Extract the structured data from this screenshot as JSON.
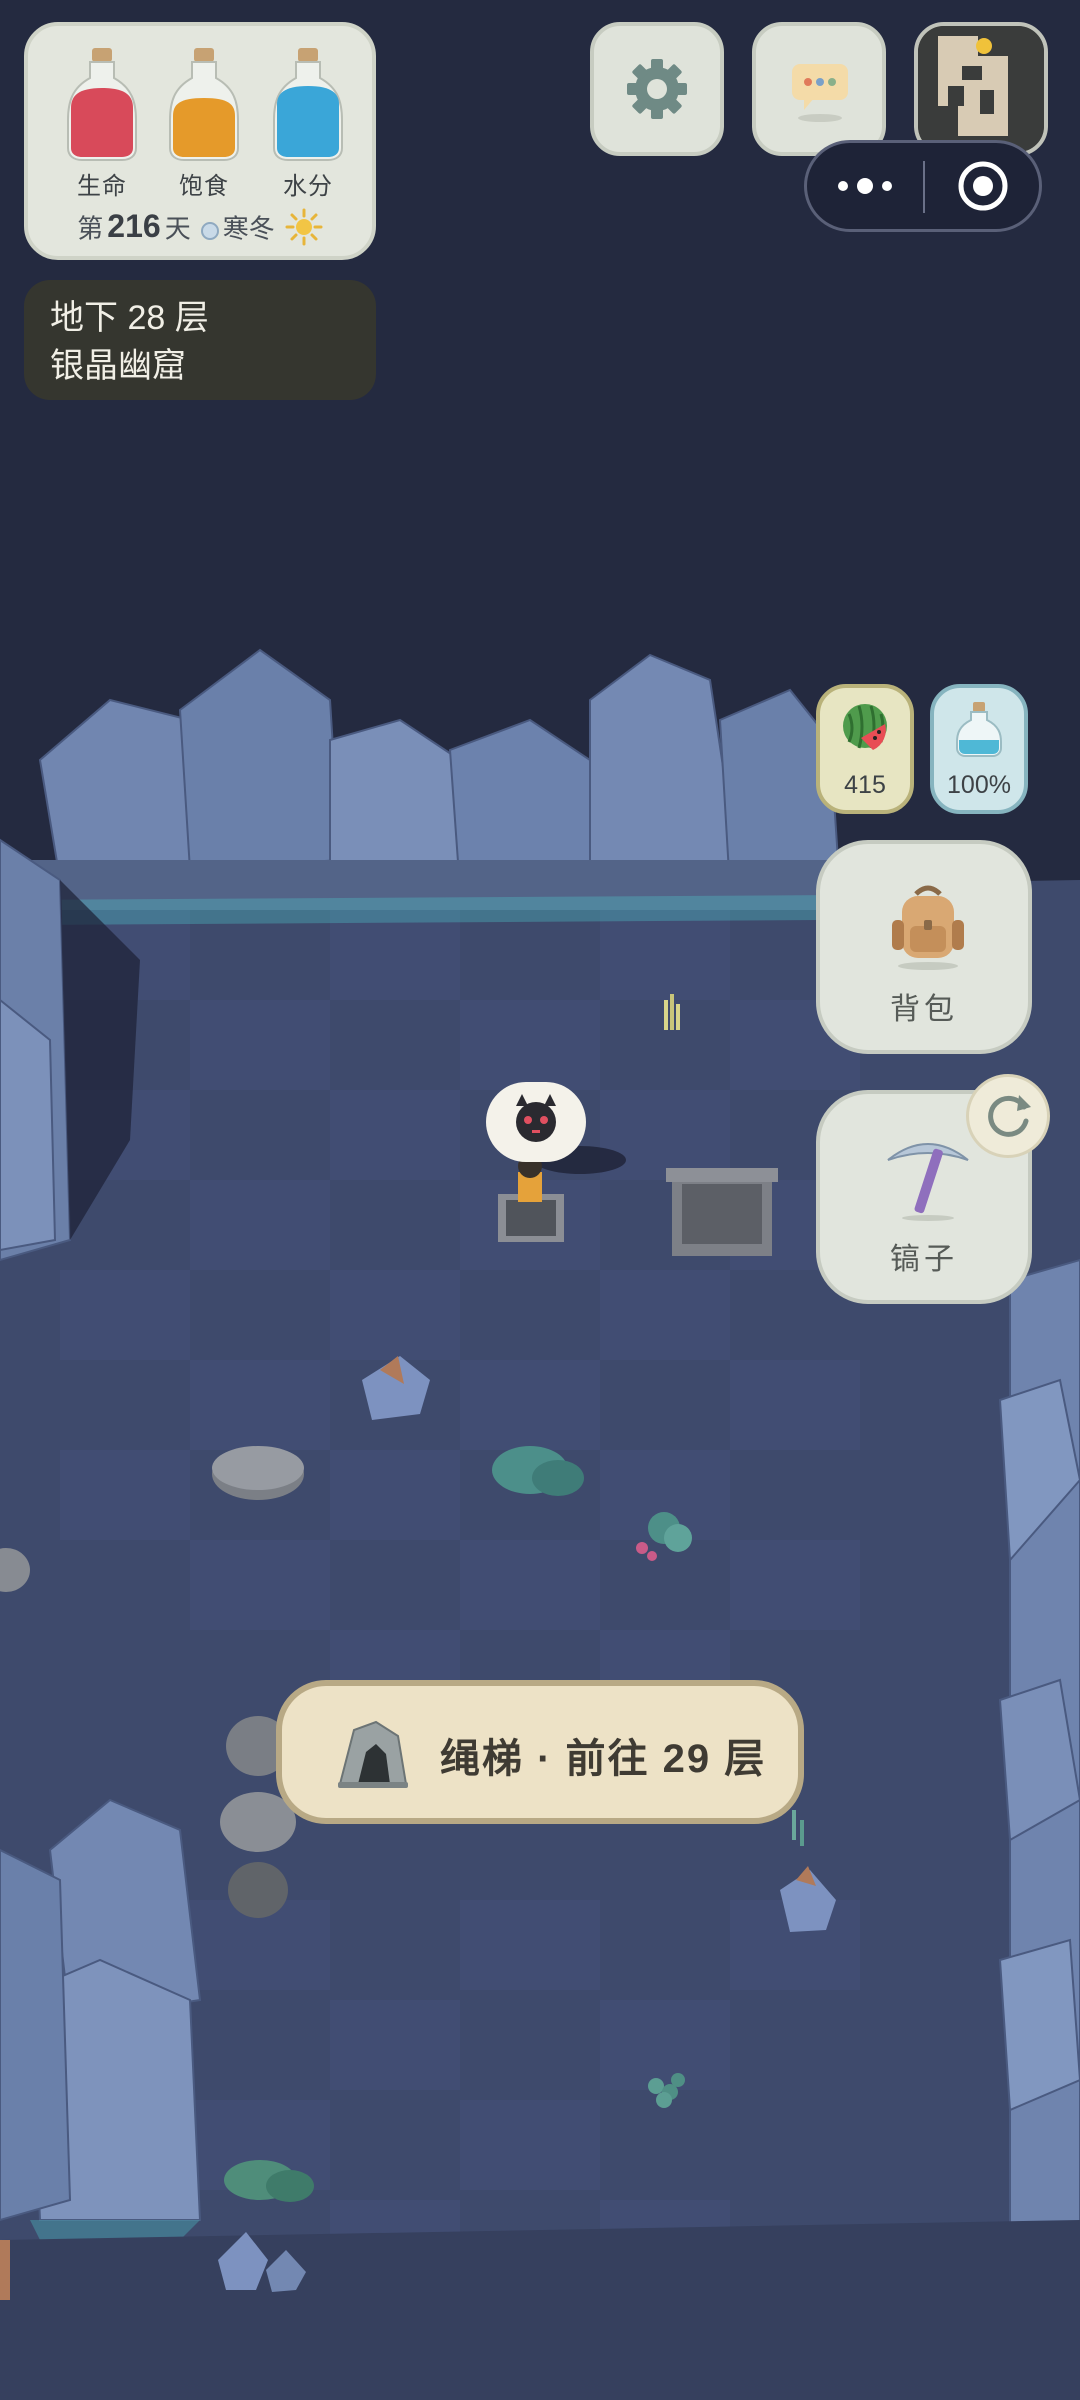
{
  "vitals": {
    "bottles": [
      {
        "label": "生命",
        "color": "#d84a5a"
      },
      {
        "label": "饱食",
        "color": "#e59a2a"
      },
      {
        "label": "水分",
        "color": "#3aa6d8"
      }
    ],
    "day_prefix": "第",
    "day_number": "216",
    "day_suffix": "天",
    "season": "寒冬",
    "weather_icon": "sun-icon"
  },
  "location": {
    "floor": "地下 28 层",
    "name": "银晶幽窟"
  },
  "top_buttons": {
    "settings_icon": "gear-icon",
    "chat_icon": "chat-bubble-icon",
    "minimap_icon": "minimap-icon",
    "more_icon": "more-dots-icon",
    "close_icon": "record-target-icon"
  },
  "side_status": {
    "food_value": "415",
    "water_value": "100%",
    "food_icon": "watermelon-icon",
    "water_icon": "water-bottle-icon"
  },
  "side_buttons": {
    "bag_label": "背包",
    "tool_label": "镐子",
    "bag_icon": "backpack-icon",
    "tool_icon": "pickaxe-icon",
    "refresh_icon": "refresh-icon"
  },
  "ladder": {
    "label": "绳梯 · 前往 29 层",
    "icon": "cave-entrance-icon"
  },
  "player": {
    "bubble_icon": "black-cat-face-icon"
  },
  "colors": {
    "sky": "#242a40",
    "floor": "#3f4a6d",
    "rock": "#6a7fa8",
    "panel": "#e3e6dd",
    "ladder_bg": "#ede2c6"
  }
}
